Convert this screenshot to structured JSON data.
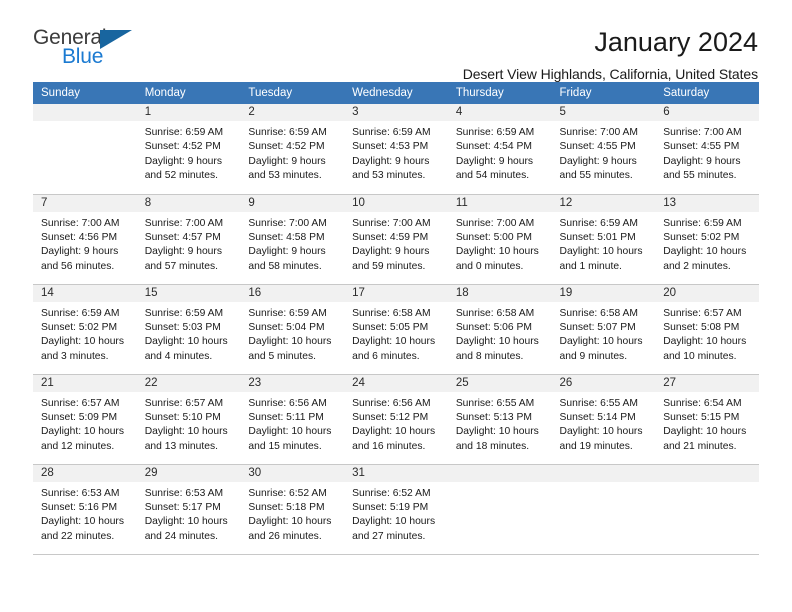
{
  "branding": {
    "logo_text_primary": "General",
    "logo_text_secondary": "Blue",
    "logo_primary_color": "#3c3c3c",
    "logo_secondary_color": "#1b7ad1",
    "logo_triangle_color": "#18659f"
  },
  "header": {
    "title": "January 2024",
    "subtitle": "Desert View Highlands, California, United States"
  },
  "theme": {
    "header_row_bg": "#3976b6",
    "header_row_text": "#ffffff",
    "daynum_band_bg": "#f1f1f1",
    "cell_bg": "#ffffff",
    "grid_line": "#c8c8c8"
  },
  "weekday_headers": [
    "Sunday",
    "Monday",
    "Tuesday",
    "Wednesday",
    "Thursday",
    "Friday",
    "Saturday"
  ],
  "weeks": [
    [
      {
        "day": "",
        "blank": true,
        "sunrise": "",
        "sunset": "",
        "daylight_line1": "",
        "daylight_line2": ""
      },
      {
        "day": "1",
        "sunrise": "Sunrise: 6:59 AM",
        "sunset": "Sunset: 4:52 PM",
        "daylight_line1": "Daylight: 9 hours",
        "daylight_line2": "and 52 minutes."
      },
      {
        "day": "2",
        "sunrise": "Sunrise: 6:59 AM",
        "sunset": "Sunset: 4:52 PM",
        "daylight_line1": "Daylight: 9 hours",
        "daylight_line2": "and 53 minutes."
      },
      {
        "day": "3",
        "sunrise": "Sunrise: 6:59 AM",
        "sunset": "Sunset: 4:53 PM",
        "daylight_line1": "Daylight: 9 hours",
        "daylight_line2": "and 53 minutes."
      },
      {
        "day": "4",
        "sunrise": "Sunrise: 6:59 AM",
        "sunset": "Sunset: 4:54 PM",
        "daylight_line1": "Daylight: 9 hours",
        "daylight_line2": "and 54 minutes."
      },
      {
        "day": "5",
        "sunrise": "Sunrise: 7:00 AM",
        "sunset": "Sunset: 4:55 PM",
        "daylight_line1": "Daylight: 9 hours",
        "daylight_line2": "and 55 minutes."
      },
      {
        "day": "6",
        "sunrise": "Sunrise: 7:00 AM",
        "sunset": "Sunset: 4:55 PM",
        "daylight_line1": "Daylight: 9 hours",
        "daylight_line2": "and 55 minutes."
      }
    ],
    [
      {
        "day": "7",
        "sunrise": "Sunrise: 7:00 AM",
        "sunset": "Sunset: 4:56 PM",
        "daylight_line1": "Daylight: 9 hours",
        "daylight_line2": "and 56 minutes."
      },
      {
        "day": "8",
        "sunrise": "Sunrise: 7:00 AM",
        "sunset": "Sunset: 4:57 PM",
        "daylight_line1": "Daylight: 9 hours",
        "daylight_line2": "and 57 minutes."
      },
      {
        "day": "9",
        "sunrise": "Sunrise: 7:00 AM",
        "sunset": "Sunset: 4:58 PM",
        "daylight_line1": "Daylight: 9 hours",
        "daylight_line2": "and 58 minutes."
      },
      {
        "day": "10",
        "sunrise": "Sunrise: 7:00 AM",
        "sunset": "Sunset: 4:59 PM",
        "daylight_line1": "Daylight: 9 hours",
        "daylight_line2": "and 59 minutes."
      },
      {
        "day": "11",
        "sunrise": "Sunrise: 7:00 AM",
        "sunset": "Sunset: 5:00 PM",
        "daylight_line1": "Daylight: 10 hours",
        "daylight_line2": "and 0 minutes."
      },
      {
        "day": "12",
        "sunrise": "Sunrise: 6:59 AM",
        "sunset": "Sunset: 5:01 PM",
        "daylight_line1": "Daylight: 10 hours",
        "daylight_line2": "and 1 minute."
      },
      {
        "day": "13",
        "sunrise": "Sunrise: 6:59 AM",
        "sunset": "Sunset: 5:02 PM",
        "daylight_line1": "Daylight: 10 hours",
        "daylight_line2": "and 2 minutes."
      }
    ],
    [
      {
        "day": "14",
        "sunrise": "Sunrise: 6:59 AM",
        "sunset": "Sunset: 5:02 PM",
        "daylight_line1": "Daylight: 10 hours",
        "daylight_line2": "and 3 minutes."
      },
      {
        "day": "15",
        "sunrise": "Sunrise: 6:59 AM",
        "sunset": "Sunset: 5:03 PM",
        "daylight_line1": "Daylight: 10 hours",
        "daylight_line2": "and 4 minutes."
      },
      {
        "day": "16",
        "sunrise": "Sunrise: 6:59 AM",
        "sunset": "Sunset: 5:04 PM",
        "daylight_line1": "Daylight: 10 hours",
        "daylight_line2": "and 5 minutes."
      },
      {
        "day": "17",
        "sunrise": "Sunrise: 6:58 AM",
        "sunset": "Sunset: 5:05 PM",
        "daylight_line1": "Daylight: 10 hours",
        "daylight_line2": "and 6 minutes."
      },
      {
        "day": "18",
        "sunrise": "Sunrise: 6:58 AM",
        "sunset": "Sunset: 5:06 PM",
        "daylight_line1": "Daylight: 10 hours",
        "daylight_line2": "and 8 minutes."
      },
      {
        "day": "19",
        "sunrise": "Sunrise: 6:58 AM",
        "sunset": "Sunset: 5:07 PM",
        "daylight_line1": "Daylight: 10 hours",
        "daylight_line2": "and 9 minutes."
      },
      {
        "day": "20",
        "sunrise": "Sunrise: 6:57 AM",
        "sunset": "Sunset: 5:08 PM",
        "daylight_line1": "Daylight: 10 hours",
        "daylight_line2": "and 10 minutes."
      }
    ],
    [
      {
        "day": "21",
        "sunrise": "Sunrise: 6:57 AM",
        "sunset": "Sunset: 5:09 PM",
        "daylight_line1": "Daylight: 10 hours",
        "daylight_line2": "and 12 minutes."
      },
      {
        "day": "22",
        "sunrise": "Sunrise: 6:57 AM",
        "sunset": "Sunset: 5:10 PM",
        "daylight_line1": "Daylight: 10 hours",
        "daylight_line2": "and 13 minutes."
      },
      {
        "day": "23",
        "sunrise": "Sunrise: 6:56 AM",
        "sunset": "Sunset: 5:11 PM",
        "daylight_line1": "Daylight: 10 hours",
        "daylight_line2": "and 15 minutes."
      },
      {
        "day": "24",
        "sunrise": "Sunrise: 6:56 AM",
        "sunset": "Sunset: 5:12 PM",
        "daylight_line1": "Daylight: 10 hours",
        "daylight_line2": "and 16 minutes."
      },
      {
        "day": "25",
        "sunrise": "Sunrise: 6:55 AM",
        "sunset": "Sunset: 5:13 PM",
        "daylight_line1": "Daylight: 10 hours",
        "daylight_line2": "and 18 minutes."
      },
      {
        "day": "26",
        "sunrise": "Sunrise: 6:55 AM",
        "sunset": "Sunset: 5:14 PM",
        "daylight_line1": "Daylight: 10 hours",
        "daylight_line2": "and 19 minutes."
      },
      {
        "day": "27",
        "sunrise": "Sunrise: 6:54 AM",
        "sunset": "Sunset: 5:15 PM",
        "daylight_line1": "Daylight: 10 hours",
        "daylight_line2": "and 21 minutes."
      }
    ],
    [
      {
        "day": "28",
        "sunrise": "Sunrise: 6:53 AM",
        "sunset": "Sunset: 5:16 PM",
        "daylight_line1": "Daylight: 10 hours",
        "daylight_line2": "and 22 minutes."
      },
      {
        "day": "29",
        "sunrise": "Sunrise: 6:53 AM",
        "sunset": "Sunset: 5:17 PM",
        "daylight_line1": "Daylight: 10 hours",
        "daylight_line2": "and 24 minutes."
      },
      {
        "day": "30",
        "sunrise": "Sunrise: 6:52 AM",
        "sunset": "Sunset: 5:18 PM",
        "daylight_line1": "Daylight: 10 hours",
        "daylight_line2": "and 26 minutes."
      },
      {
        "day": "31",
        "sunrise": "Sunrise: 6:52 AM",
        "sunset": "Sunset: 5:19 PM",
        "daylight_line1": "Daylight: 10 hours",
        "daylight_line2": "and 27 minutes."
      },
      {
        "day": "",
        "blank": true,
        "sunrise": "",
        "sunset": "",
        "daylight_line1": "",
        "daylight_line2": ""
      },
      {
        "day": "",
        "blank": true,
        "sunrise": "",
        "sunset": "",
        "daylight_line1": "",
        "daylight_line2": ""
      },
      {
        "day": "",
        "blank": true,
        "sunrise": "",
        "sunset": "",
        "daylight_line1": "",
        "daylight_line2": ""
      }
    ]
  ]
}
